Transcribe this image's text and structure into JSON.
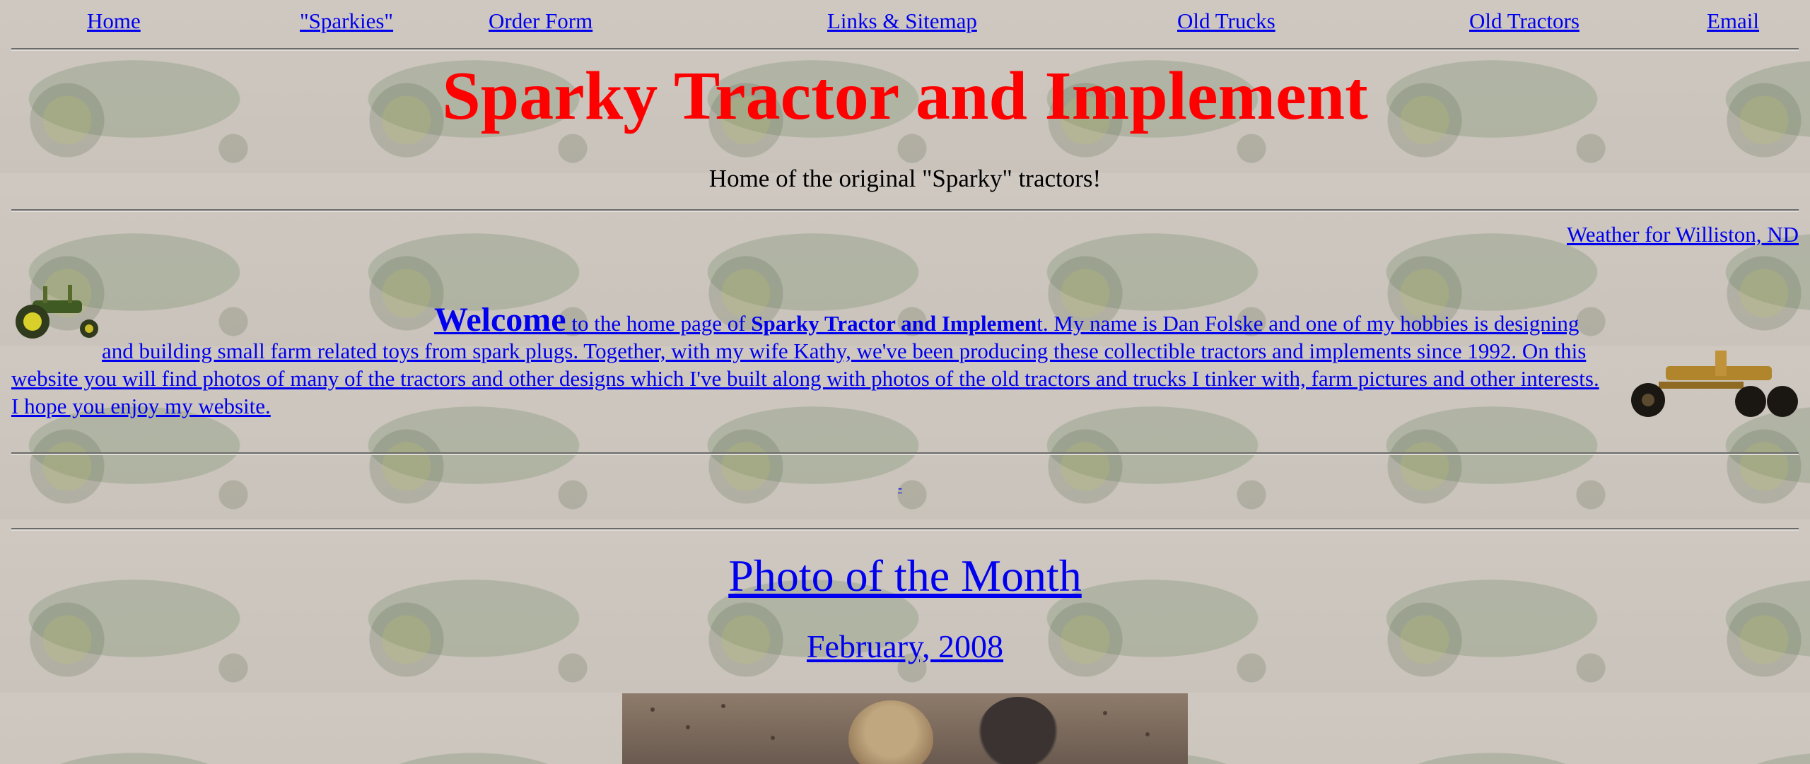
{
  "nav": [
    {
      "label": "Home"
    },
    {
      "label": "\"Sparkies\""
    },
    {
      "label": "Order Form"
    },
    {
      "label": "Links & Sitemap"
    },
    {
      "label": "Old Trucks"
    },
    {
      "label": "Old Tractors"
    },
    {
      "label": "Email"
    }
  ],
  "header": {
    "title": "Sparky Tractor and Implement",
    "tagline": "Home of the original \"Sparky\" tractors!",
    "title_color": "#ff0000"
  },
  "weather_link": "Weather for Williston, ND",
  "intro": {
    "welcome": "Welcome",
    "text_before_company": " to the home page of ",
    "company": "Sparky Tractor and Implemen",
    "text_after_company": "t. My name is Dan Folske and one of my hobbies is designing and building small farm related toys from spark plugs. Together, with my wife Kathy, we've been producing these collectible tractors and implements since 1992.  On this website you will find photos of many of the tractors and other designs which I've built along with photos of the old tractors and trucks I tinker with, farm pictures and other interests.   I hope you enjoy my website."
  },
  "small_link": "-",
  "photo_of_month": {
    "title": "Photo of the Month",
    "date": "February, 2008"
  },
  "colors": {
    "link": "#0000ee",
    "background": "#cdc7bf"
  }
}
